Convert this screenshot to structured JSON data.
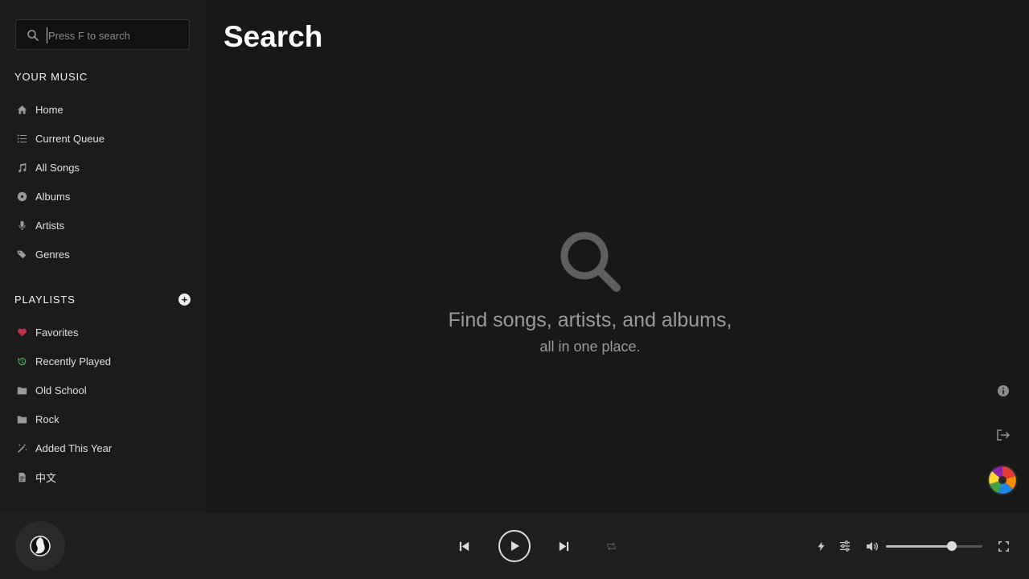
{
  "search": {
    "placeholder": "Press F to search"
  },
  "sidebar": {
    "music_title": "YOUR MUSIC",
    "music_items": [
      {
        "label": "Home",
        "icon": "home-icon"
      },
      {
        "label": "Current Queue",
        "icon": "queue-icon"
      },
      {
        "label": "All Songs",
        "icon": "music-note-icon"
      },
      {
        "label": "Albums",
        "icon": "disc-icon"
      },
      {
        "label": "Artists",
        "icon": "microphone-icon"
      },
      {
        "label": "Genres",
        "icon": "tags-icon"
      }
    ],
    "playlists_title": "PLAYLISTS",
    "playlists": [
      {
        "label": "Favorites",
        "icon": "heart-icon"
      },
      {
        "label": "Recently Played",
        "icon": "history-icon"
      },
      {
        "label": "Old School",
        "icon": "folder-icon"
      },
      {
        "label": "Rock",
        "icon": "folder-icon"
      },
      {
        "label": "Added This Year",
        "icon": "magic-wand-icon"
      },
      {
        "label": "中文",
        "icon": "file-icon"
      }
    ]
  },
  "main": {
    "title": "Search",
    "empty_line1": "Find songs, artists, and albums,",
    "empty_line2": "all in one place."
  },
  "player": {
    "volume": 0.68
  },
  "colors": {
    "background": "#181818",
    "sidebar": "#1b1b1b",
    "footer": "#1f1f1f",
    "favorite": "#c0304a",
    "recent": "#4caf50"
  }
}
